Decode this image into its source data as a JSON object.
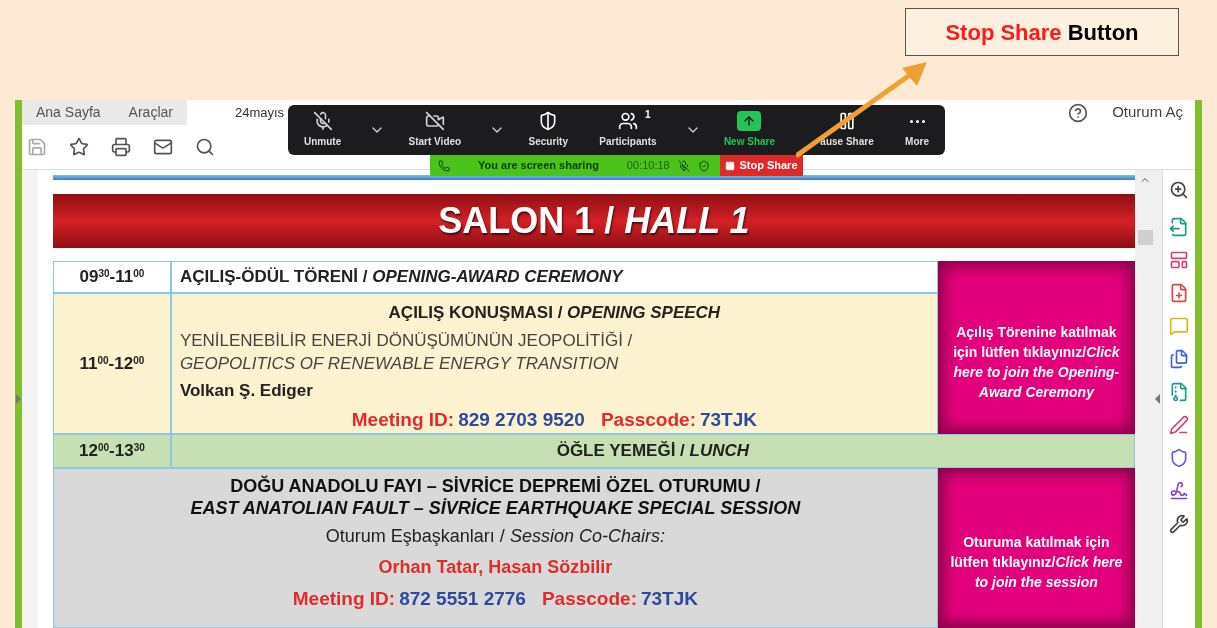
{
  "callout": {
    "highlight": "Stop Share",
    "rest": "Button"
  },
  "app": {
    "tabs": [
      {
        "label": "Ana Sayfa",
        "selected": false
      },
      {
        "label": "Araçlar",
        "selected": false
      },
      {
        "label": "24mayıs",
        "selected": true
      }
    ],
    "sign_in": "Oturum Aç"
  },
  "meeting_toolbar": {
    "buttons": [
      {
        "label": "Unmute",
        "caret": true,
        "highlight": false
      },
      {
        "label": "Start Video",
        "caret": true,
        "highlight": false
      },
      {
        "label": "Security",
        "caret": false,
        "highlight": false
      },
      {
        "label": "Participants",
        "count": "1",
        "caret": true,
        "highlight": false
      },
      {
        "label": "New Share",
        "caret": false,
        "highlight": true
      },
      {
        "label": "ause Share",
        "caret": false,
        "highlight": false
      },
      {
        "label": "More",
        "caret": false,
        "highlight": false
      }
    ],
    "sharing": {
      "text": "You are screen sharing",
      "timer": "00:10:18",
      "stop": "Stop Share"
    }
  },
  "document": {
    "banner": "SALON 1 / *HALL 1*",
    "rows": [
      {
        "kind": "simple",
        "time": "09$^{30}$-11$^{00}$",
        "title": "AÇILIŞ-ÖDÜL TÖRENİ / *OPENING-AWARD CEREMONY*"
      },
      {
        "kind": "talk",
        "time": "11$^{00}$-12$^{00}$",
        "heading": "AÇILIŞ KONUŞMASI / *OPENING SPEECH*",
        "subtitle": [
          "YENİLENEBİLİR ENERJİ DÖNÜŞÜMÜNÜN JEOPOLİTİĞİ /",
          "GEOPOLITICS OF RENEWABLE ENERGY TRANSITION"
        ],
        "speaker": "Volkan Ş. Ediger",
        "meeting": {
          "id_label": "Meeting ID:",
          "id": "829 2703 9520",
          "pass_label": "Passcode:",
          "pass": "73TJK"
        }
      },
      {
        "kind": "break",
        "time": "12$^{00}$-13$^{30}$",
        "title": "ÖĞLE YEMEĞİ / *LUNCH*"
      },
      {
        "kind": "session",
        "title": [
          "DOĞU ANADOLU FAYI – SİVRİCE DEPREMİ ÖZEL OTURUMU /",
          "EAST ANATOLIAN FAULT – SİVRİCE EARTHQUAKE SPECIAL SESSION"
        ],
        "chairs": "Oturum Eşbaşkanları / *Session Co-Chairs:*",
        "names": "Orhan Tatar, Hasan Sözbilir",
        "meeting": {
          "id_label": "Meeting ID:",
          "id": "872 5551 2776",
          "pass_label": "Passcode:",
          "pass": "73TJK"
        }
      }
    ],
    "join_buttons": [
      "Açılış Törenine katılmak için lütfen tıklayınız/*Click here to join the Opening-Award Ceremony*",
      "Oturuma katılmak için lütfen tıklayınız/*Click here to join the session*"
    ]
  }
}
